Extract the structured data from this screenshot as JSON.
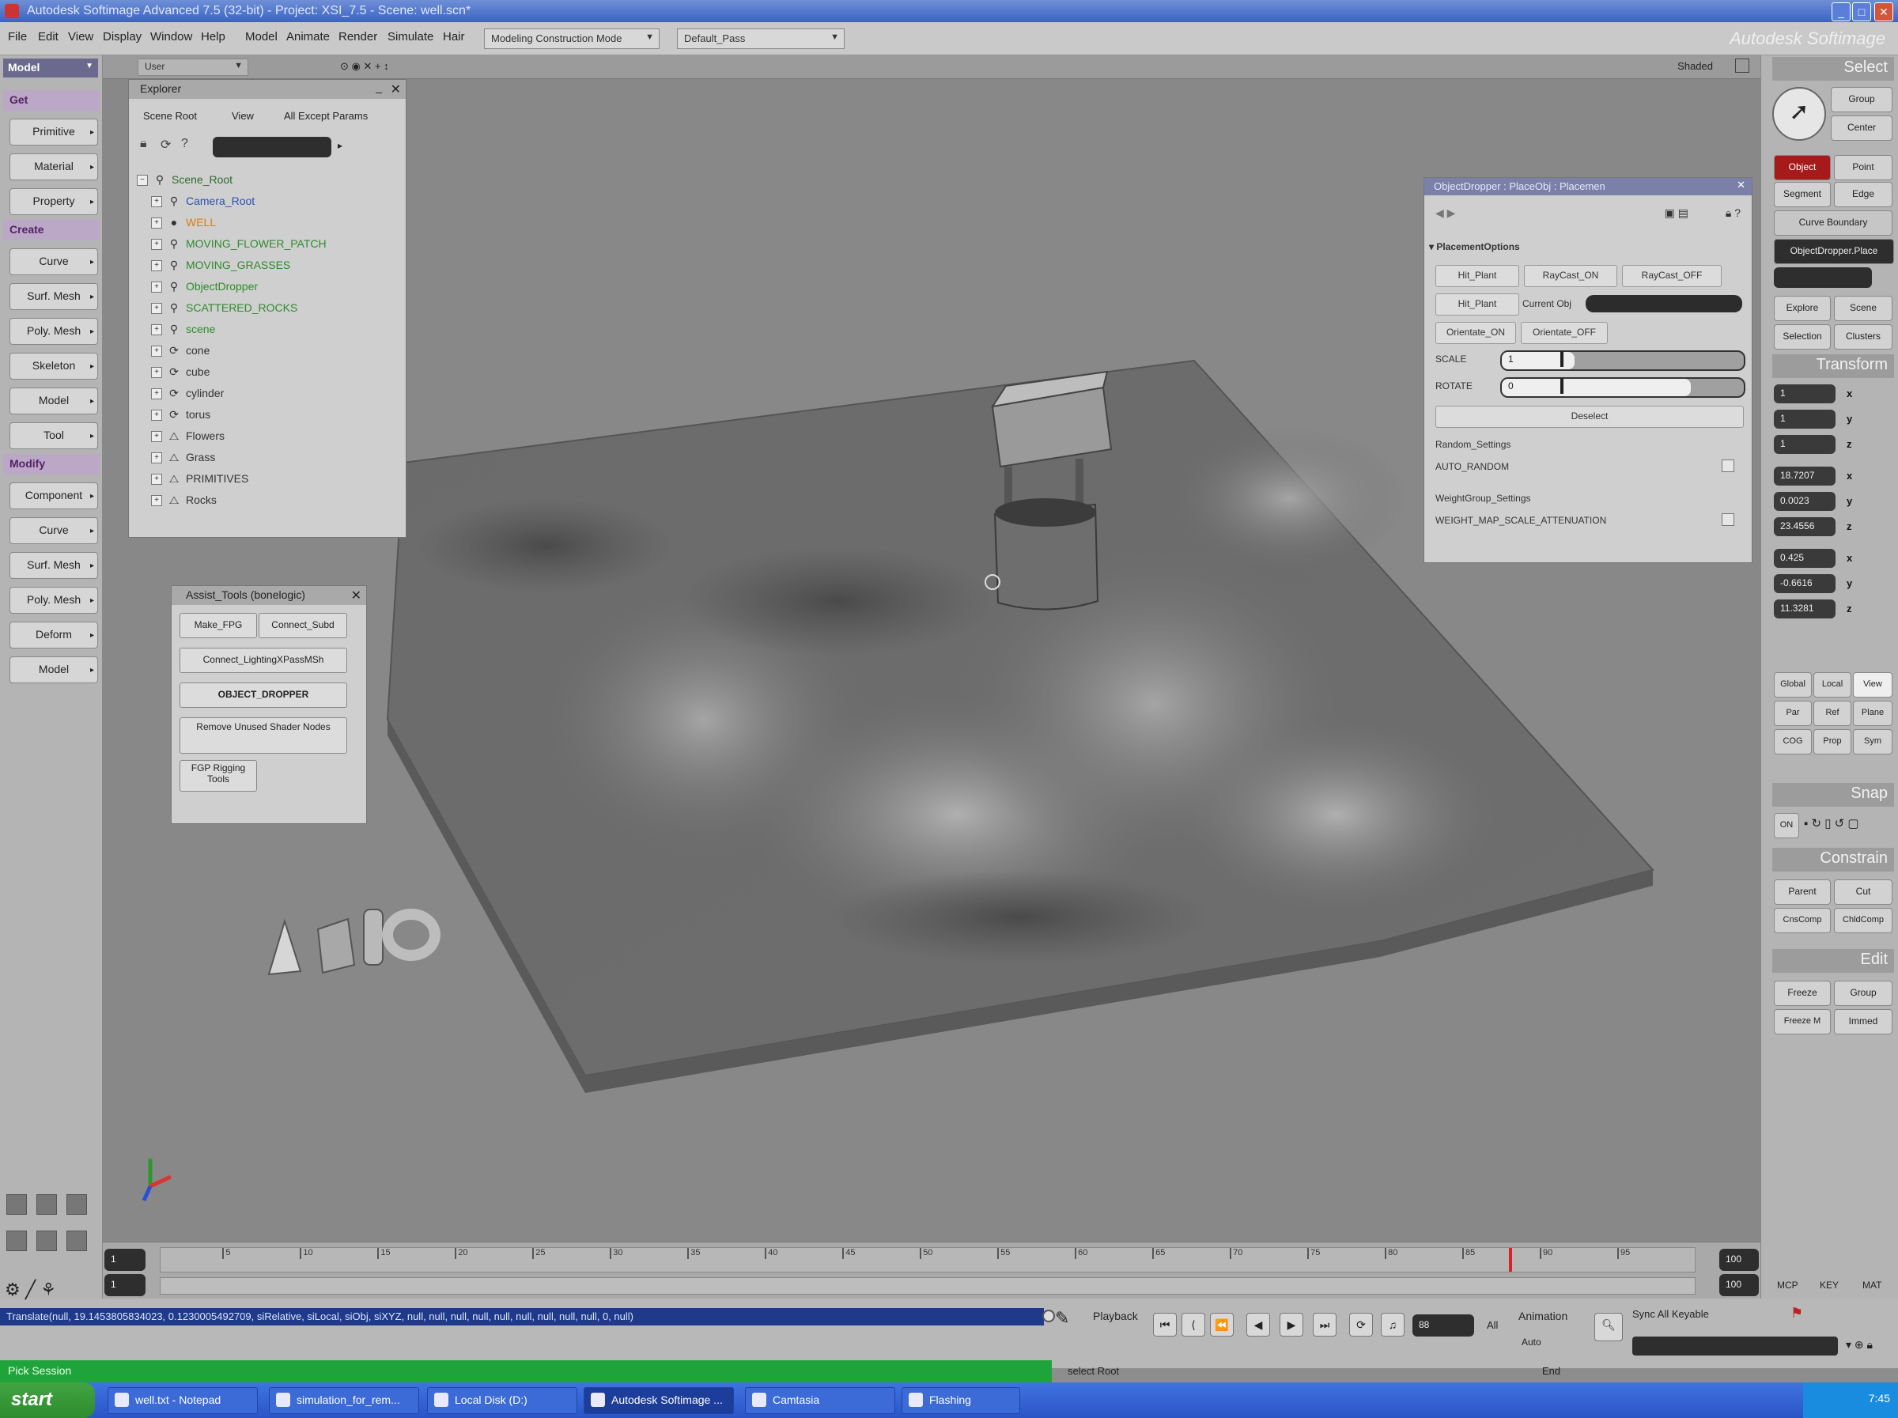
{
  "window": {
    "title": "Autodesk Softimage Advanced 7.5 (32-bit) - Project: XSI_7.5 - Scene: well.scn*",
    "brand": "Autodesk Softimage"
  },
  "menubar": {
    "items": [
      "File",
      "Edit",
      "View",
      "Display",
      "Window",
      "Help",
      "Model",
      "Animate",
      "Render",
      "Simulate",
      "Hair"
    ],
    "construction_mode": "Modeling Construction Mode",
    "pass": "Default_Pass"
  },
  "left_toolbar": {
    "mode": "Model",
    "sections": {
      "get": "Get",
      "create": "Create",
      "modify": "Modify"
    },
    "get_buttons": [
      "Primitive",
      "Material",
      "Property"
    ],
    "create_buttons": [
      "Curve",
      "Surf. Mesh",
      "Poly. Mesh",
      "Skeleton",
      "Model",
      "Tool"
    ],
    "modify_buttons": [
      "Component",
      "Curve",
      "Surf. Mesh",
      "Poly. Mesh",
      "Deform",
      "Model"
    ]
  },
  "viewport": {
    "camera": "User",
    "view_mode": "Shaded"
  },
  "explorer": {
    "title": "Explorer",
    "menus": [
      "Scene Root",
      "View",
      "All Except Params"
    ],
    "tree": [
      {
        "label": "Scene_Root",
        "color": "#2e6b2e"
      },
      {
        "label": "Camera_Root",
        "color": "#2a4fb4"
      },
      {
        "label": "WELL",
        "color": "#e07a10"
      },
      {
        "label": "MOVING_FLOWER_PATCH",
        "color": "#2e8b2e"
      },
      {
        "label": "MOVING_GRASSES",
        "color": "#2e8b2e"
      },
      {
        "label": "ObjectDropper",
        "color": "#2e8b2e"
      },
      {
        "label": "SCATTERED_ROCKS",
        "color": "#2e8b2e"
      },
      {
        "label": "scene",
        "color": "#2e8b2e"
      },
      {
        "label": "cone",
        "color": "#333333"
      },
      {
        "label": "cube",
        "color": "#333333"
      },
      {
        "label": "cylinder",
        "color": "#333333"
      },
      {
        "label": "torus",
        "color": "#333333"
      },
      {
        "label": "Flowers",
        "color": "#333333"
      },
      {
        "label": "Grass",
        "color": "#333333"
      },
      {
        "label": "PRIMITIVES",
        "color": "#333333"
      },
      {
        "label": "Rocks",
        "color": "#333333"
      }
    ]
  },
  "assist_tools": {
    "title": "Assist_Tools (bonelogic)",
    "buttons": [
      "Make_FPG",
      "Connect_Subd",
      "Connect_LightingXPassMSh",
      "OBJECT_DROPPER",
      "Remove Unused Shader Nodes",
      "FGP Rigging Tools"
    ]
  },
  "object_dropper": {
    "title": "ObjectDropper : PlaceObj : Placemen",
    "section": "PlacementOptions",
    "buttons_row1": [
      "Hit_Plant",
      "RayCast_ON",
      "RayCast_OFF"
    ],
    "buttons_row2": [
      "Hit_Plant",
      "Current Obj"
    ],
    "buttons_row3": [
      "Orientate_ON",
      "Orientate_OFF"
    ],
    "scale_label": "SCALE",
    "scale_value": "1",
    "scale_level": 0.3,
    "rotate_label": "ROTATE",
    "rotate_value": "0",
    "rotate_level": 0.78,
    "deselect_label": "Deselect",
    "random_settings": "Random_Settings",
    "random_value": "AUTO_RANDOM",
    "weight_settings": "WeightGroup_Settings",
    "weight_value": "WEIGHT_MAP_SCALE_ATTENUATION"
  },
  "right_panel": {
    "select_header": "Select",
    "select_buttons": [
      "Group",
      "Center",
      "Object",
      "Point",
      "Segment",
      "Edge"
    ],
    "curve_boundary": "Curve Boundary",
    "selected_object": "ObjectDropper.Place",
    "explore": "Explore",
    "scene": "Scene",
    "selection": "Selection",
    "clusters": "Clusters",
    "transform_header": "Transform",
    "scale": [
      "1",
      "1",
      "1"
    ],
    "rotate": [
      "18.7207",
      "0.0023",
      "23.4556"
    ],
    "translate": [
      "0.425",
      "-0.6616",
      "11.3281"
    ],
    "axes": [
      "x",
      "y",
      "z"
    ],
    "ref_buttons": [
      "Global",
      "Local",
      "View",
      "Par",
      "Ref",
      "Plane",
      "COG",
      "Prop",
      "Sym"
    ],
    "snap_header": "Snap",
    "snap_on": "ON",
    "constrain_header": "Constrain",
    "constrain_buttons": [
      "Parent",
      "Cut",
      "CnsComp",
      "ChldComp"
    ],
    "edit_header": "Edit",
    "edit_buttons": [
      "Freeze",
      "Group",
      "Freeze M",
      "Immed"
    ],
    "bottom_tabs": [
      "MCP",
      "KEY",
      "MAT"
    ]
  },
  "timeline": {
    "start": "1",
    "end": "100",
    "current": "1",
    "ticks": [
      "5",
      "10",
      "15",
      "20",
      "25",
      "30",
      "35",
      "40",
      "45",
      "50",
      "55",
      "60",
      "65",
      "70",
      "75",
      "80",
      "85",
      "90",
      "95"
    ],
    "playhead_frame": 88
  },
  "command": {
    "script": "Translate(null, 19.1453805834023, 0.1230005492709, siRelative, siLocal, siObj, siXYZ, null, null, null, null, null, null, null, null, null, 0, null)",
    "status": "Pick Session",
    "playback_label": "Playback",
    "animation_label": "Animation",
    "frame_value": "88",
    "all_label": "All",
    "keyable_label": "Sync All Keyable",
    "auto_label": "Auto",
    "select_root": "select Root",
    "end_label": "End"
  },
  "taskbar": {
    "start": "start",
    "tasks": [
      "well.txt - Notepad",
      "simulation_for_rem...",
      "Local Disk (D:)",
      "Autodesk Softimage ...",
      "Camtasia",
      "Flashing"
    ],
    "active_index": 3,
    "clock": "7:45"
  }
}
